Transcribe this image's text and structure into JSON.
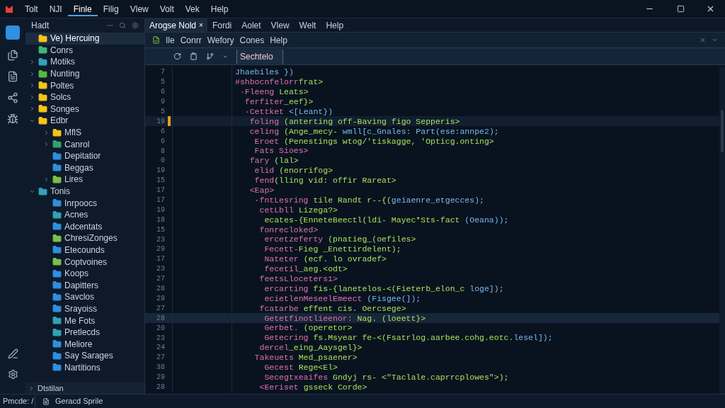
{
  "menu_bar": {
    "items": [
      {
        "label": "Tolt",
        "selected": false
      },
      {
        "label": "NJI",
        "selected": false
      },
      {
        "label": "Finle",
        "selected": true
      },
      {
        "label": "Filig",
        "selected": false
      },
      {
        "label": "Vlew",
        "selected": false
      },
      {
        "label": "Volt",
        "selected": false
      },
      {
        "label": "Vek",
        "selected": false
      },
      {
        "label": "Help",
        "selected": false
      }
    ]
  },
  "activity_bar": {
    "items": [
      {
        "kind": "logo",
        "selected": true
      },
      {
        "kind": "files",
        "selected": false
      },
      {
        "kind": "document",
        "selected": false
      },
      {
        "kind": "share",
        "selected": false
      },
      {
        "kind": "debug",
        "selected": false
      }
    ],
    "bottom": [
      {
        "kind": "edit"
      },
      {
        "kind": "settings"
      }
    ]
  },
  "sidebar": {
    "title": "Hadt",
    "items": [
      {
        "label": "Ve) Hercuing",
        "selected": true,
        "color": "#f5c518"
      },
      {
        "label": "Conrs",
        "selected": false,
        "color": "#3fb67a"
      },
      {
        "label": "Motiks",
        "selected": false,
        "expanded": false,
        "color": "#2fa3b8"
      },
      {
        "label": "Nunting",
        "selected": false,
        "expanded": false,
        "color": "#58b840"
      },
      {
        "label": "Poltes",
        "selected": false,
        "expanded": false,
        "color": "#f5c518"
      },
      {
        "label": "Solcs",
        "selected": false,
        "expanded": false,
        "color": "#f5c518"
      },
      {
        "label": "Songes",
        "selected": false,
        "expanded": false,
        "color": "#f5c518"
      },
      {
        "label": "Edbr",
        "selected": false,
        "expanded": true,
        "color": "#f5c518",
        "children": [
          {
            "label": "MflS",
            "selected": false,
            "expanded": false,
            "color": "#f5c518"
          },
          {
            "label": "Canrol",
            "selected": false,
            "expanded": false,
            "color": "#2fa36b"
          },
          {
            "label": "Depitatior",
            "selected": false,
            "color": "#2f8fe0"
          },
          {
            "label": "Beggas",
            "selected": false,
            "color": "#2f8fe0"
          },
          {
            "label": "Lires",
            "selected": false,
            "expanded": false,
            "color": "#7cc04a"
          }
        ]
      },
      {
        "label": "Tonis",
        "selected": false,
        "expanded": true,
        "color": "#2fa3b8",
        "children": [
          {
            "label": "Inrpoocs",
            "selected": false,
            "color": "#2f8fe0"
          },
          {
            "label": "Acnes",
            "selected": false,
            "color": "#2fa3b8"
          },
          {
            "label": "Adcentats",
            "selected": false,
            "color": "#2f8fe0"
          },
          {
            "label": "ChresiZonges",
            "selected": false,
            "color": "#7cc04a"
          },
          {
            "label": "Etecounds",
            "selected": false,
            "color": "#2f8fe0"
          },
          {
            "label": "Coptvoines",
            "selected": false,
            "color": "#7cc04a"
          },
          {
            "label": "Koops",
            "selected": false,
            "color": "#2f8fe0"
          },
          {
            "label": "Dapitters",
            "selected": false,
            "color": "#2f8fe0"
          },
          {
            "label": "Savclos",
            "selected": false,
            "color": "#2f8fe0"
          },
          {
            "label": "Srayoiss",
            "selected": false,
            "color": "#2f8fe0"
          },
          {
            "label": "Me Fots",
            "selected": false,
            "color": "#2fa3b8"
          },
          {
            "label": "Pretlecds",
            "selected": false,
            "color": "#2fa3b8"
          },
          {
            "label": "Meliore",
            "selected": false,
            "color": "#2f8fe0"
          },
          {
            "label": "Say Sarages",
            "selected": false,
            "color": "#2f8fe0"
          },
          {
            "label": "Nartitions",
            "selected": false,
            "color": "#2f8fe0"
          }
        ]
      }
    ],
    "footer": {
      "label": "Dtstilan",
      "expanded": false
    }
  },
  "editor": {
    "tabs": [
      {
        "label": "Arogse Nold",
        "selected": true,
        "close": "×"
      }
    ],
    "tab_menu": [
      "Fordi",
      "Aolet",
      "Vlew",
      "Welt",
      "Help"
    ],
    "menu": [
      "Ile",
      "Conrr",
      "Wefory",
      "Cones",
      "Help"
    ],
    "toolbar": {
      "buttons": [
        {
          "kind": "refresh"
        },
        {
          "kind": "clipboard"
        },
        {
          "kind": "branch"
        },
        {
          "kind": "caret"
        }
      ],
      "field_value": "Sechtelo"
    },
    "lines": [
      {
        "number": "7",
        "tokens": [
          {
            "kind": "name",
            "text": "Jhaebiles })"
          }
        ]
      },
      {
        "number": "5",
        "tokens": [
          {
            "kind": "keyword",
            "text": "#shbocnfelorr"
          },
          {
            "kind": "string",
            "text": "frat>"
          }
        ]
      },
      {
        "number": "6",
        "tokens": [
          {
            "kind": "keyword",
            "text": " ·Fleeng "
          },
          {
            "kind": "string",
            "text": "Leats>"
          }
        ]
      },
      {
        "number": "9",
        "tokens": [
          {
            "kind": "keyword",
            "text": "  ferfiter"
          },
          {
            "kind": "string",
            "text": "_eef}>"
          }
        ]
      },
      {
        "number": "5",
        "tokens": [
          {
            "kind": "keyword",
            "text": "  ·Cettket "
          },
          {
            "kind": "name",
            "text": "<[Leant})"
          }
        ]
      },
      {
        "number": "19",
        "marker": true,
        "tokens": [
          {
            "kind": "keyword",
            "text": "   foling "
          },
          {
            "kind": "string",
            "text": "(anterting off-Baving figo Sepperis>"
          }
        ]
      },
      {
        "number": "6",
        "tokens": [
          {
            "kind": "keyword",
            "text": "   celing "
          },
          {
            "kind": "string",
            "text": "(Ange_mecy- "
          },
          {
            "kind": "name",
            "text": "wmll[c_Gnales: Part(ese:annpe2);"
          }
        ]
      },
      {
        "number": "6",
        "tokens": [
          {
            "kind": "keyword",
            "text": "    Eroet "
          },
          {
            "kind": "string",
            "text": "(Penestings wtog/'tiskagge, 'Opticg.onting>"
          }
        ]
      },
      {
        "number": "8",
        "tokens": [
          {
            "kind": "keyword",
            "text": "    Fats Sioes>"
          }
        ]
      },
      {
        "number": "0",
        "tokens": [
          {
            "kind": "keyword",
            "text": "   fary "
          },
          {
            "kind": "string",
            "text": "(lal>"
          }
        ]
      },
      {
        "number": "19",
        "tokens": [
          {
            "kind": "keyword",
            "text": "    elid "
          },
          {
            "kind": "string",
            "text": "(enorrifog>"
          }
        ]
      },
      {
        "number": "15",
        "tokens": [
          {
            "kind": "keyword",
            "text": "    fend"
          },
          {
            "kind": "string",
            "text": "(lling vid: offir Rareat>"
          }
        ]
      },
      {
        "number": "17",
        "tokens": [
          {
            "kind": "keyword",
            "text": "   <Eap>"
          }
        ]
      },
      {
        "number": "17",
        "tokens": [
          {
            "kind": "keyword",
            "text": "    ·fntLesring "
          },
          {
            "kind": "string",
            "text": "tile Randt r--{("
          },
          {
            "kind": "name",
            "text": "geiaenre_etgecces);"
          }
        ]
      },
      {
        "number": "19",
        "tokens": [
          {
            "kind": "keyword",
            "text": "     cetLbll "
          },
          {
            "kind": "string",
            "text": "Lizega?>"
          }
        ]
      },
      {
        "number": "18",
        "tokens": [
          {
            "kind": "string",
            "text": "      ecates-{EnneteBeectl(ldi- Mayec*Sts-fact "
          },
          {
            "kind": "name",
            "text": "(Oeana));"
          }
        ]
      },
      {
        "number": "15",
        "tokens": [
          {
            "kind": "keyword",
            "text": "     fonrecloked>"
          }
        ]
      },
      {
        "number": "23",
        "tokens": [
          {
            "kind": "keyword",
            "text": "      ercetzeferty "
          },
          {
            "kind": "string",
            "text": "(pnatieg_(oefiles>"
          }
        ]
      },
      {
        "number": "29",
        "tokens": [
          {
            "kind": "keyword",
            "text": "      Fecett-"
          },
          {
            "kind": "string",
            "text": "Fieg _Enettirdelent);"
          }
        ]
      },
      {
        "number": "17",
        "tokens": [
          {
            "kind": "keyword",
            "text": "      Nateter "
          },
          {
            "kind": "string",
            "text": "(ecf. lo ovradef>"
          }
        ]
      },
      {
        "number": "23",
        "tokens": [
          {
            "kind": "keyword",
            "text": "      fecetil"
          },
          {
            "kind": "string",
            "text": "_aeg.<odt>"
          }
        ]
      },
      {
        "number": "27",
        "tokens": [
          {
            "kind": "keyword",
            "text": "     feetsLloceters1>"
          }
        ]
      },
      {
        "number": "28",
        "tokens": [
          {
            "kind": "keyword",
            "text": "      ercarting "
          },
          {
            "kind": "string",
            "text": "fis-{lanetelos-<(Fieterb_elon_c "
          },
          {
            "kind": "name",
            "text": "loge]);"
          }
        ]
      },
      {
        "number": "29",
        "tokens": [
          {
            "kind": "keyword",
            "text": "      ecietlenMeseelEmeect "
          },
          {
            "kind": "name",
            "text": "(Fisgee(]);"
          }
        ]
      },
      {
        "number": "27",
        "tokens": [
          {
            "kind": "keyword",
            "text": "     fcatarbe "
          },
          {
            "kind": "string",
            "text": "effent cis. Oercsege>"
          }
        ]
      },
      {
        "number": "28",
        "current": true,
        "tokens": [
          {
            "kind": "keyword",
            "text": "      Getetfinotlieenor: "
          },
          {
            "kind": "string",
            "text": "Nag. (loeett}>"
          }
        ]
      },
      {
        "number": "20",
        "tokens": [
          {
            "kind": "keyword",
            "text": "      Gerbet. "
          },
          {
            "kind": "string",
            "text": "(operetor>"
          }
        ]
      },
      {
        "number": "23",
        "tokens": [
          {
            "kind": "keyword",
            "text": "      Getecring "
          },
          {
            "kind": "string",
            "text": "fs.Msyear fe-<(Fsatrlog.aarbee.cohg.eotc."
          },
          {
            "kind": "name",
            "text": "lesel]);"
          }
        ]
      },
      {
        "number": "24",
        "tokens": [
          {
            "kind": "keyword",
            "text": "     dercel"
          },
          {
            "kind": "string",
            "text": "_eing_Aaysgel}>"
          }
        ]
      },
      {
        "number": "27",
        "tokens": [
          {
            "kind": "keyword",
            "text": "    Takeuets "
          },
          {
            "kind": "string",
            "text": "Med_psaener>"
          }
        ]
      },
      {
        "number": "38",
        "tokens": [
          {
            "kind": "keyword",
            "text": "      Gecest "
          },
          {
            "kind": "string",
            "text": "Rege<El>"
          }
        ]
      },
      {
        "number": "29",
        "tokens": [
          {
            "kind": "keyword",
            "text": "      Secegtxeaifes "
          },
          {
            "kind": "string",
            "text": "Gndyj rs- <\"Taclale.caprrcplowes\">);"
          }
        ]
      },
      {
        "number": "28",
        "tokens": [
          {
            "kind": "keyword",
            "text": "     <Eeriset "
          },
          {
            "kind": "string",
            "text": "gsseck Corde>"
          }
        ]
      }
    ]
  },
  "status_bar": {
    "mode": "Pmcde: /",
    "branch": "Geracd Sprile"
  }
}
